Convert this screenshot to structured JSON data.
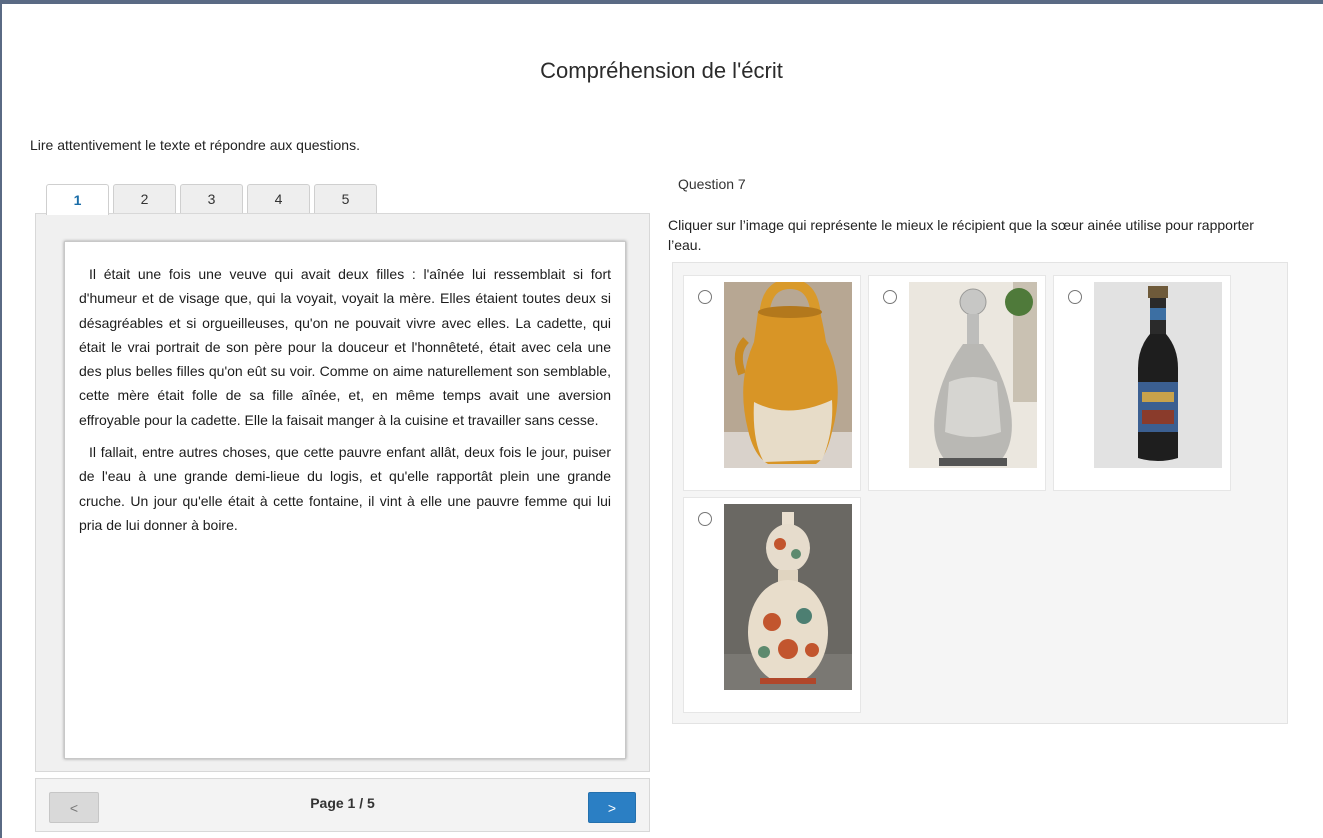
{
  "page": {
    "title": "Compréhension de l'écrit",
    "instructions": "Lire attentivement le texte et répondre aux questions."
  },
  "tabs": [
    {
      "label": "1",
      "active": true
    },
    {
      "label": "2",
      "active": false
    },
    {
      "label": "3",
      "active": false
    },
    {
      "label": "4",
      "active": false
    },
    {
      "label": "5",
      "active": false
    }
  ],
  "reading": {
    "paragraphs": [
      "Il était une fois une veuve qui avait deux filles : l'aînée lui ressemblait si fort d'humeur et de visage que, qui la voyait, voyait la mère. Elles étaient toutes deux si désagréables et si orgueilleuses, qu'on ne pouvait vivre avec elles. La cadette, qui était le vrai portrait de son père pour la douceur et l'honnêteté, était avec cela une des plus belles filles qu'on eût su voir. Comme on aime naturellement son semblable, cette mère était folle de sa fille aînée, et, en même temps avait une aversion effroyable pour la cadette. Elle la faisait manger à la cuisine et travailler sans cesse.",
      "Il fallait, entre autres choses, que cette pauvre enfant allât, deux fois le jour, puiser de l'eau à une grande demi-lieue du logis, et qu'elle rapportât plein une grande cruche. Un jour qu'elle était à cette fontaine, il vint à elle une pauvre femme qui lui pria de lui donner à boire."
    ]
  },
  "pager": {
    "prev_label": "<",
    "next_label": ">",
    "page_label": "Page 1 / 5"
  },
  "question": {
    "title": "Question 7",
    "text": "Cliquer sur l’image qui représente le mieux le récipient que la sœur ainée utilise pour rapporter l’eau.",
    "options": [
      {
        "image": "clay-jug-image",
        "selected": false
      },
      {
        "image": "glass-decanter-image",
        "selected": false
      },
      {
        "image": "dark-bottle-image",
        "selected": false
      },
      {
        "image": "double-gourd-vase-image",
        "selected": false
      }
    ]
  },
  "colors": {
    "accent": "#2b7fc4",
    "frame": "#5a6a84",
    "panel_bg": "#f0f0f0"
  }
}
